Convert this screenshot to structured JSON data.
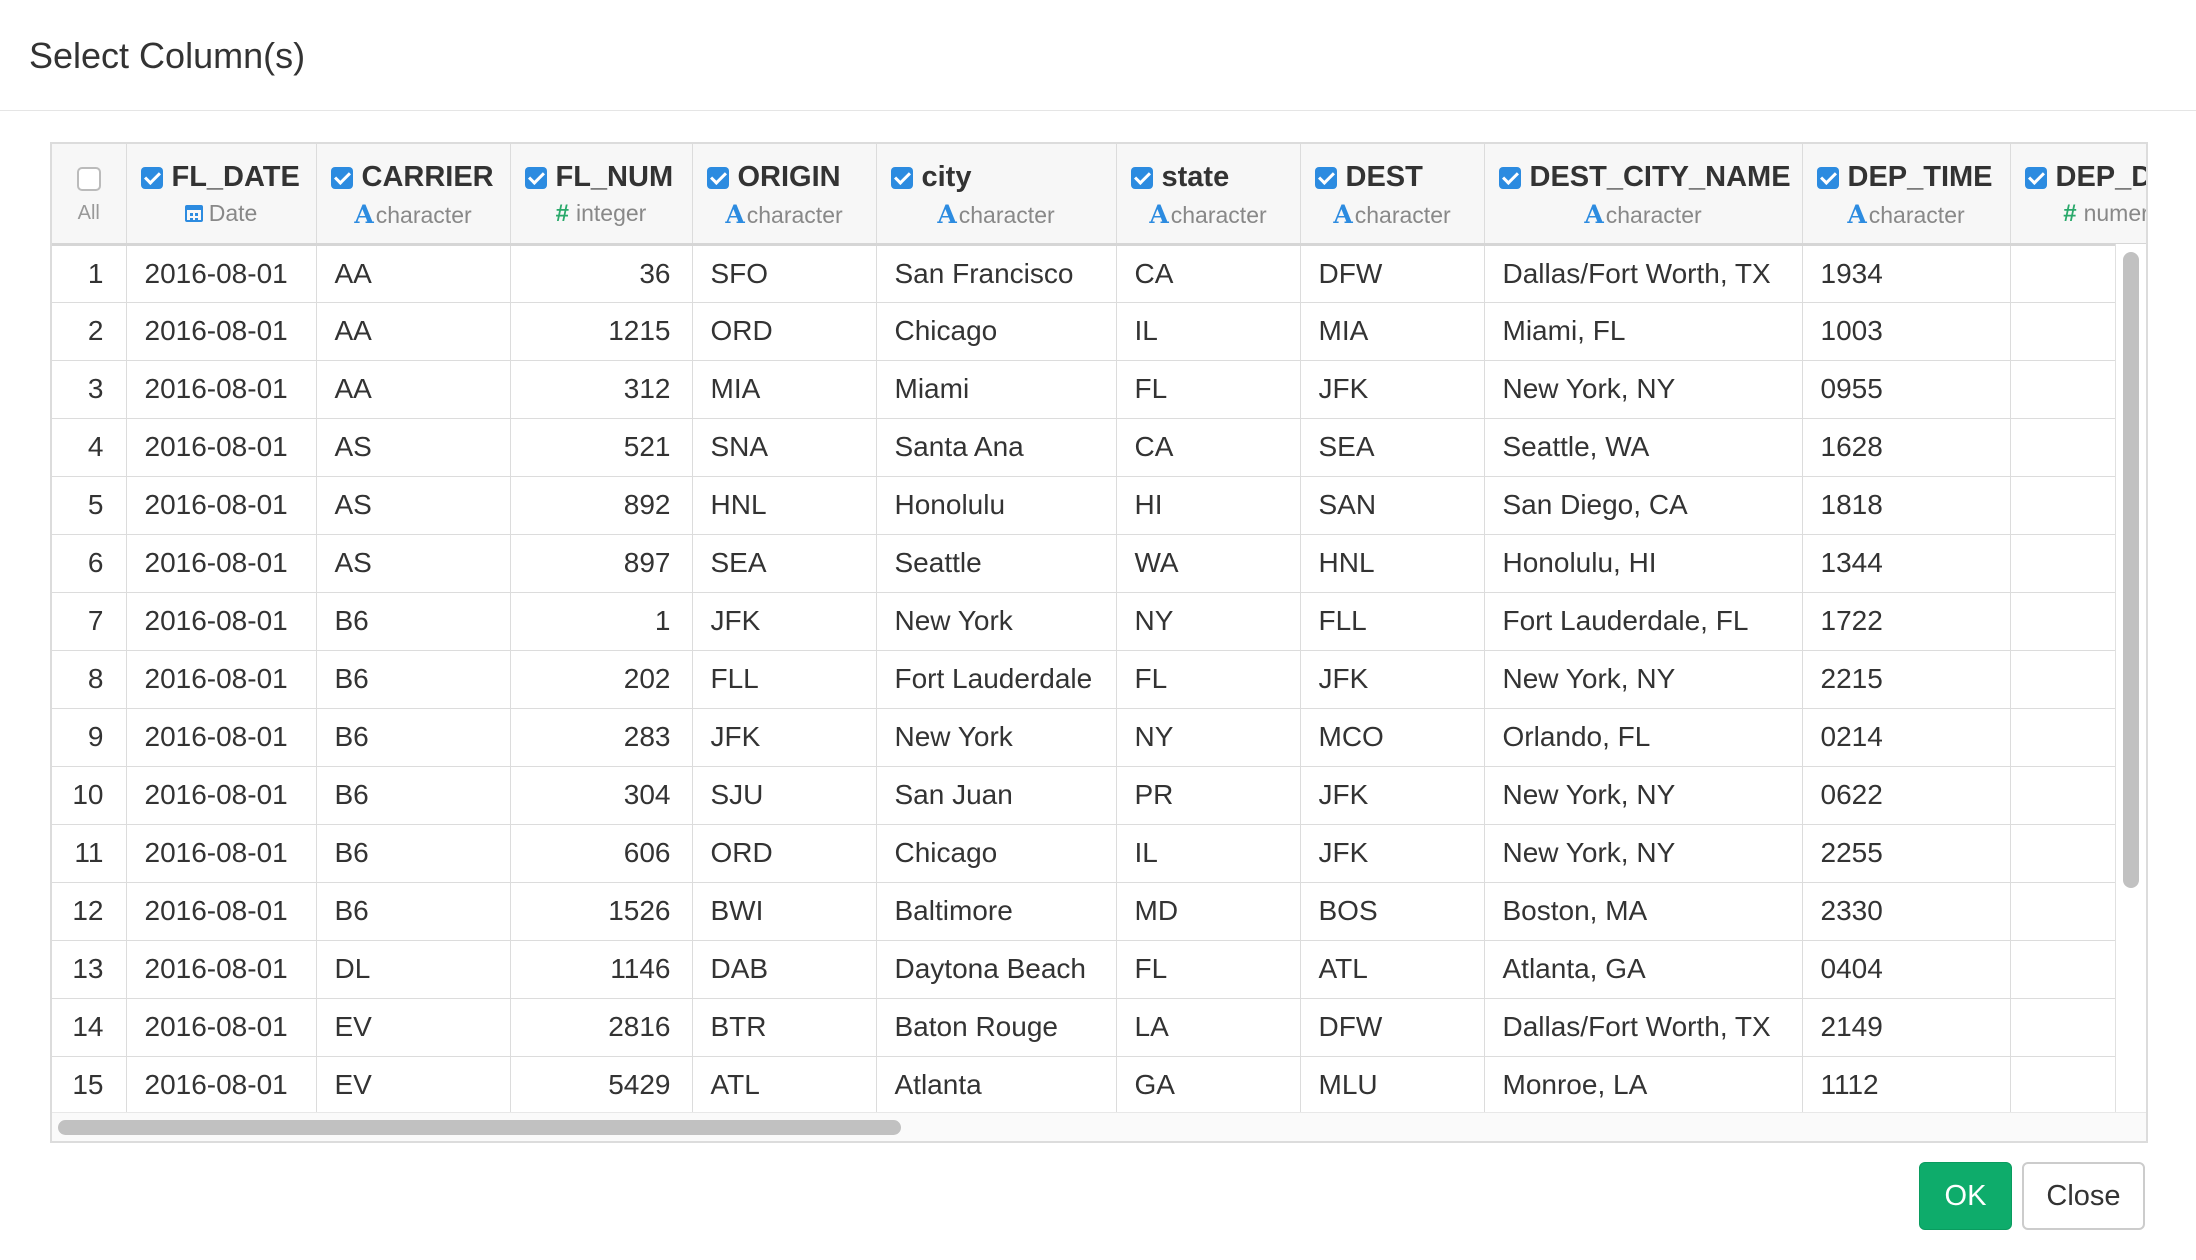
{
  "dialog": {
    "title": "Select Column(s)"
  },
  "table": {
    "all_label": "All",
    "columns": [
      {
        "name": "FL_DATE",
        "type": "Date",
        "icon": "calendar-icon",
        "checked": true
      },
      {
        "name": "CARRIER",
        "type": "character",
        "icon": "character-type-icon",
        "checked": true
      },
      {
        "name": "FL_NUM",
        "type": "integer",
        "icon": "hash-icon",
        "checked": true
      },
      {
        "name": "ORIGIN",
        "type": "character",
        "icon": "character-type-icon",
        "checked": true
      },
      {
        "name": "city",
        "type": "character",
        "icon": "character-type-icon",
        "checked": true
      },
      {
        "name": "state",
        "type": "character",
        "icon": "character-type-icon",
        "checked": true
      },
      {
        "name": "DEST",
        "type": "character",
        "icon": "character-type-icon",
        "checked": true
      },
      {
        "name": "DEST_CITY_NAME",
        "type": "character",
        "icon": "character-type-icon",
        "checked": true
      },
      {
        "name": "DEP_TIME",
        "type": "character",
        "icon": "character-type-icon",
        "checked": true
      },
      {
        "name": "DEP_D",
        "type": "numer",
        "icon": "hash-icon",
        "checked": true
      }
    ],
    "rows": [
      {
        "n": "1",
        "cells": [
          "2016-08-01",
          "AA",
          "36",
          "SFO",
          "San Francisco",
          "CA",
          "DFW",
          "Dallas/Fort Worth, TX",
          "1934",
          ""
        ]
      },
      {
        "n": "2",
        "cells": [
          "2016-08-01",
          "AA",
          "1215",
          "ORD",
          "Chicago",
          "IL",
          "MIA",
          "Miami, FL",
          "1003",
          ""
        ]
      },
      {
        "n": "3",
        "cells": [
          "2016-08-01",
          "AA",
          "312",
          "MIA",
          "Miami",
          "FL",
          "JFK",
          "New York, NY",
          "0955",
          ""
        ]
      },
      {
        "n": "4",
        "cells": [
          "2016-08-01",
          "AS",
          "521",
          "SNA",
          "Santa Ana",
          "CA",
          "SEA",
          "Seattle, WA",
          "1628",
          ""
        ]
      },
      {
        "n": "5",
        "cells": [
          "2016-08-01",
          "AS",
          "892",
          "HNL",
          "Honolulu",
          "HI",
          "SAN",
          "San Diego, CA",
          "1818",
          ""
        ]
      },
      {
        "n": "6",
        "cells": [
          "2016-08-01",
          "AS",
          "897",
          "SEA",
          "Seattle",
          "WA",
          "HNL",
          "Honolulu, HI",
          "1344",
          ""
        ]
      },
      {
        "n": "7",
        "cells": [
          "2016-08-01",
          "B6",
          "1",
          "JFK",
          "New York",
          "NY",
          "FLL",
          "Fort Lauderdale, FL",
          "1722",
          ""
        ]
      },
      {
        "n": "8",
        "cells": [
          "2016-08-01",
          "B6",
          "202",
          "FLL",
          "Fort Lauderdale",
          "FL",
          "JFK",
          "New York, NY",
          "2215",
          ""
        ]
      },
      {
        "n": "9",
        "cells": [
          "2016-08-01",
          "B6",
          "283",
          "JFK",
          "New York",
          "NY",
          "MCO",
          "Orlando, FL",
          "0214",
          ""
        ]
      },
      {
        "n": "10",
        "cells": [
          "2016-08-01",
          "B6",
          "304",
          "SJU",
          "San Juan",
          "PR",
          "JFK",
          "New York, NY",
          "0622",
          ""
        ]
      },
      {
        "n": "11",
        "cells": [
          "2016-08-01",
          "B6",
          "606",
          "ORD",
          "Chicago",
          "IL",
          "JFK",
          "New York, NY",
          "2255",
          ""
        ]
      },
      {
        "n": "12",
        "cells": [
          "2016-08-01",
          "B6",
          "1526",
          "BWI",
          "Baltimore",
          "MD",
          "BOS",
          "Boston, MA",
          "2330",
          ""
        ]
      },
      {
        "n": "13",
        "cells": [
          "2016-08-01",
          "DL",
          "1146",
          "DAB",
          "Daytona Beach",
          "FL",
          "ATL",
          "Atlanta, GA",
          "0404",
          ""
        ]
      },
      {
        "n": "14",
        "cells": [
          "2016-08-01",
          "EV",
          "2816",
          "BTR",
          "Baton Rouge",
          "LA",
          "DFW",
          "Dallas/Fort Worth, TX",
          "2149",
          ""
        ]
      },
      {
        "n": "15",
        "cells": [
          "2016-08-01",
          "EV",
          "5429",
          "ATL",
          "Atlanta",
          "GA",
          "MLU",
          "Monroe, LA",
          "1112",
          ""
        ]
      }
    ]
  },
  "footer": {
    "ok_label": "OK",
    "close_label": "Close"
  },
  "colors": {
    "accent": "#2c8be0",
    "ok_button": "#0eac6b",
    "numeric_icon": "#2aa96b"
  }
}
